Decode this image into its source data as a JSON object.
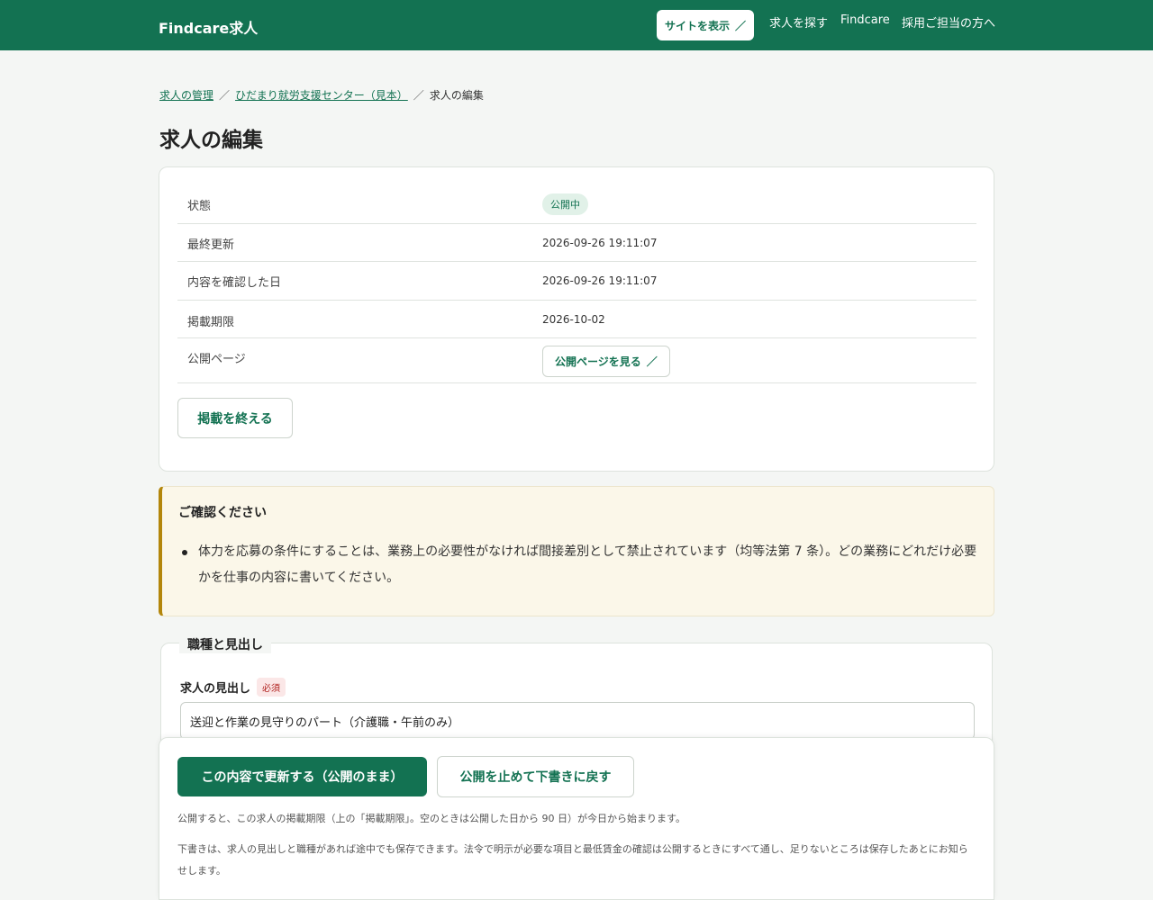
{
  "header": {
    "brand": "Findcare求人",
    "site_button": "サイトを表示",
    "nav": [
      "求人を探す",
      "Findcare",
      "採用ご担当の方へ"
    ]
  },
  "breadcrumb": {
    "items": [
      "求人の管理",
      "ひだまり就労支援センター（見本）",
      "求人の編集"
    ],
    "separator": "／"
  },
  "page_title": "求人の編集",
  "status_card": {
    "rows": [
      {
        "label": "状態",
        "value": "公開中"
      },
      {
        "label": "最終更新",
        "value": "2026-09-26 19:11:07"
      },
      {
        "label": "内容を確認した日",
        "value": "2026-09-26 19:11:07"
      },
      {
        "label": "掲載期限",
        "value": "2026-10-02"
      },
      {
        "label": "公開ページ",
        "value": "公開ページを見る"
      }
    ],
    "end_button": "掲載を終える"
  },
  "notice": {
    "title": "ご確認ください",
    "items": [
      "体力を応募の条件にすることは、業務上の必要性がなければ間接差別として禁止されています（均等法第 7 条）。どの業務にどれだけ必要かを仕事の内容に書いてください。"
    ]
  },
  "section": {
    "legend": "職種と見出し",
    "field_label": "求人の見出し",
    "required_badge": "必須",
    "field_value": "送迎と作業の見守りのパート（介護職・午前のみ）"
  },
  "footer": {
    "primary_button": "この内容で更新する（公開のまま）",
    "secondary_button": "公開を止めて下書きに戻す",
    "notes": [
      "公開すると、この求人の掲載期限（上の「掲載期限」。空のときは公開した日から 90 日）が今日から始まります。",
      "下書きは、求人の見出しと職種があれば途中でも保存できます。法令で明示が必要な項目と最低賃金の確認は公開するときにすべて通し、足りないところは保存したあとにお知らせします。"
    ]
  },
  "colors": {
    "brand_green": "#137252",
    "notice_border": "#b3860b",
    "required_red": "#b0211e"
  },
  "icons": {
    "external_link": "external-link-icon"
  }
}
